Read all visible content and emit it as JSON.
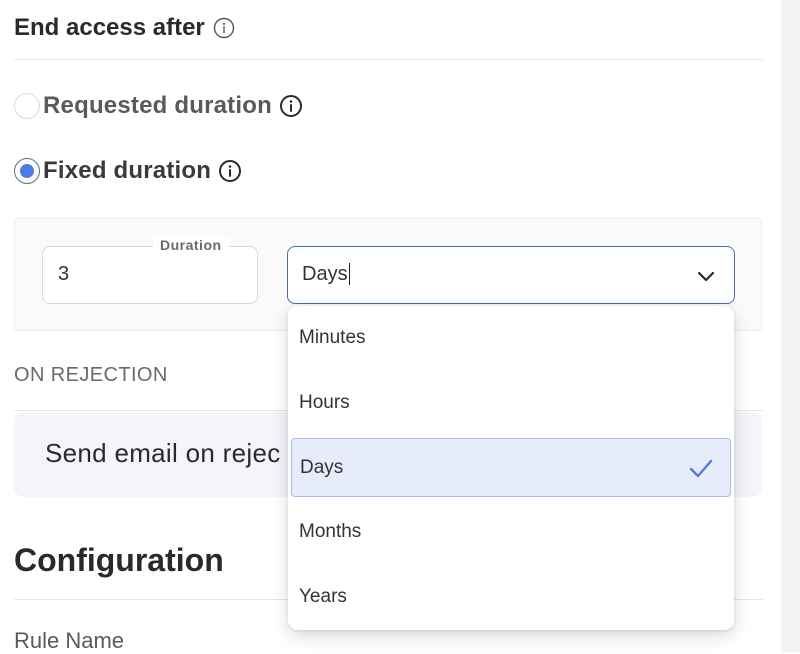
{
  "end_access": {
    "title": "End access after",
    "options": [
      {
        "label": "Requested duration",
        "checked": false
      },
      {
        "label": "Fixed duration",
        "checked": true
      }
    ]
  },
  "duration": {
    "label": "Duration",
    "value": "3",
    "unit_selected": "Days",
    "unit_options": [
      "Minutes",
      "Hours",
      "Days",
      "Months",
      "Years"
    ]
  },
  "on_rejection": {
    "heading": "ON REJECTION",
    "send_email_label": "Send email on rejec"
  },
  "configuration": {
    "title": "Configuration",
    "rule_name_label": "Rule Name"
  },
  "colors": {
    "accent": "#4f7be8",
    "focus_border": "#4b69b8",
    "selected_option_bg": "#e6ecf9"
  },
  "icons": [
    "info-icon",
    "chevron-down-icon",
    "checkmark-icon"
  ]
}
